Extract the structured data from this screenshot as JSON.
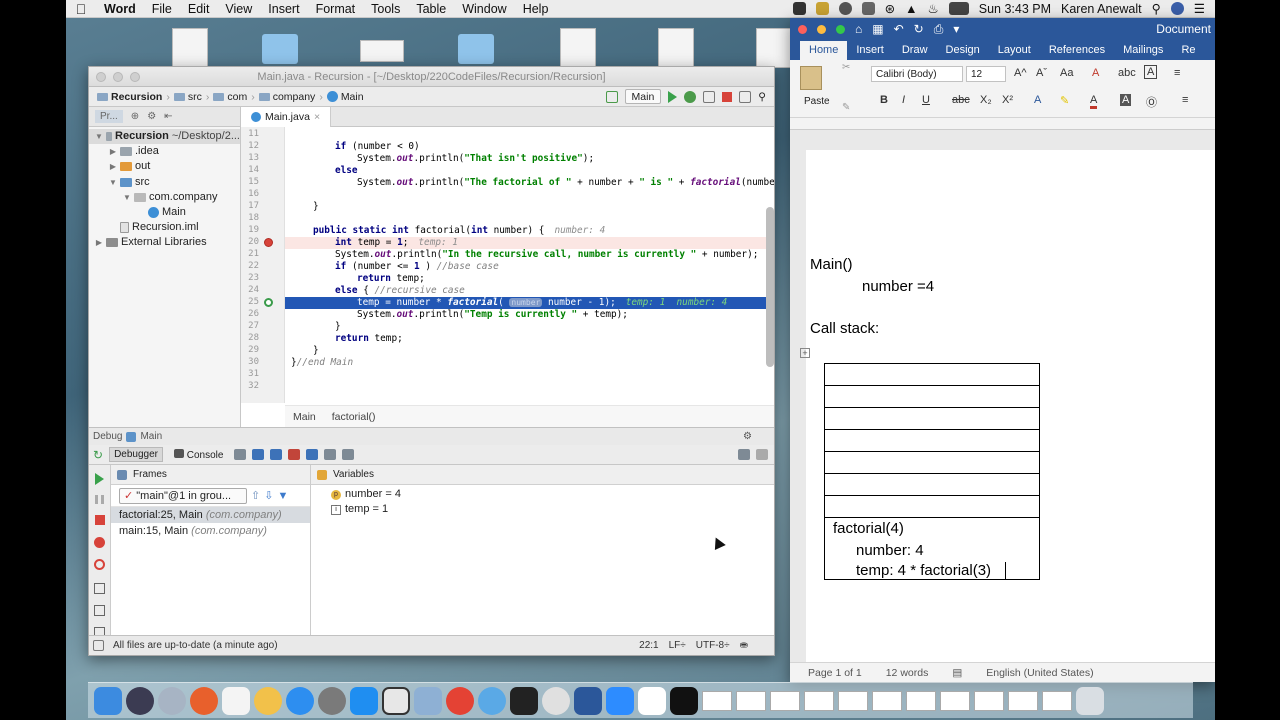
{
  "menubar": {
    "app": "Word",
    "items": [
      "File",
      "Edit",
      "View",
      "Insert",
      "Format",
      "Tools",
      "Table",
      "Window",
      "Help"
    ],
    "clock": "Sun 3:43 PM",
    "user": "Karen Anewalt"
  },
  "intellij": {
    "title": "Main.java - Recursion - [~/Desktop/220CodeFiles/Recursion/Recursion]",
    "nav": [
      "Recursion",
      "src",
      "com",
      "company",
      "Main"
    ],
    "run_config": "Main",
    "project_tab": "Pr...",
    "editor_tab": "Main.java",
    "tree": [
      {
        "label": "Recursion",
        "extra": "~/Desktop/2...",
        "icon": "gray",
        "indent": 0,
        "twisty": "▼",
        "bold": true
      },
      {
        "label": ".idea",
        "icon": "gray",
        "indent": 1,
        "twisty": "▶"
      },
      {
        "label": "out",
        "icon": "orange",
        "indent": 1,
        "twisty": "▶"
      },
      {
        "label": "src",
        "icon": "blue",
        "indent": 1,
        "twisty": "▼"
      },
      {
        "label": "com.company",
        "icon": "pkg",
        "indent": 2,
        "twisty": "▼"
      },
      {
        "label": "Main",
        "icon": "class",
        "indent": 3,
        "twisty": ""
      },
      {
        "label": "Recursion.iml",
        "icon": "file",
        "indent": 1,
        "twisty": ""
      },
      {
        "label": "External Libraries",
        "icon": "lib",
        "indent": 0,
        "twisty": "▶"
      }
    ],
    "line_numbers": [
      "11",
      "12",
      "13",
      "14",
      "15",
      "16",
      "17",
      "18",
      "19",
      "20",
      "21",
      "22",
      "23",
      "24",
      "25",
      "26",
      "27",
      "28",
      "29",
      "30",
      "31",
      "32"
    ],
    "code": {
      "l12_a": "if",
      "l12_b": " (number < 0)",
      "l13_a": "System.",
      "l13_b": "out",
      "l13_c": ".println(",
      "l13_d": "\"That isn't positive\"",
      "l13_e": ");",
      "l14": "else",
      "l15_a": "System.",
      "l15_b": "out",
      "l15_c": ".println(",
      "l15_d": "\"The factorial of \"",
      "l15_e": " + number + ",
      "l15_f": "\" is \"",
      "l15_g": " + ",
      "l15_h": "factorial",
      "l15_i": "(number",
      "l17": "}",
      "l19_a": "public static int",
      "l19_b": " factorial(",
      "l19_c": "int",
      "l19_d": " number) {",
      "l19_hint": "number: 4",
      "l20_a": "int",
      "l20_b": " temp = ",
      "l20_c": "1",
      "l20_d": ";",
      "l20_hint": "temp: 1",
      "l21_a": "System.",
      "l21_b": "out",
      "l21_c": ".println(",
      "l21_d": "\"In the recursive call, number is currently \"",
      "l21_e": " + number);",
      "l22_a": "if",
      "l22_b": " (number <= ",
      "l22_c": "1",
      "l22_d": " ) ",
      "l22_e": "//base case",
      "l23_a": "return",
      "l23_b": " temp;",
      "l24_a": "else",
      "l24_b": " { ",
      "l24_c": "//recursive case",
      "l25_a": "temp = number * ",
      "l25_b": "factorial",
      "l25_c": "( ",
      "l25_d": "number",
      "l25_e": " number - ",
      "l25_f": "1",
      "l25_g": ");",
      "l25_hint": "temp: 1  number: 4",
      "l26_a": "System.",
      "l26_b": "out",
      "l26_c": ".println(",
      "l26_d": "\"Temp is currently \"",
      "l26_e": " + temp);",
      "l27": "}",
      "l28_a": "return",
      "l28_b": " temp;",
      "l29": "}",
      "l30_a": "}",
      "l30_b": "//end Main"
    },
    "editor_breadcrumb": [
      "Main",
      "factorial()"
    ],
    "debug_label": "Debug",
    "debug_config": "Main",
    "debugger_tab": "Debugger",
    "console_tab": "Console",
    "frames_label": "Frames",
    "variables_label": "Variables",
    "thread": "\"main\"@1 in grou...",
    "frames": [
      {
        "method": "factorial:25, Main",
        "pkg": "(com.company)"
      },
      {
        "method": "main:15, Main",
        "pkg": "(com.company)"
      }
    ],
    "variables": [
      {
        "badge": "p",
        "text": "number = 4"
      },
      {
        "badge": "i",
        "text": "temp = 1"
      }
    ],
    "status": "All files are up-to-date (a minute ago)",
    "status_right": [
      "22:1",
      "LF÷",
      "UTF-8÷"
    ]
  },
  "word": {
    "title": "Document",
    "ribbon_tabs": [
      "Home",
      "Insert",
      "Draw",
      "Design",
      "Layout",
      "References",
      "Mailings",
      "Re"
    ],
    "font": "Calibri (Body)",
    "font_size": "12",
    "paste_label": "Paste",
    "doc": {
      "line1": "Main()",
      "line2": "number  =4",
      "line3": "Call stack:",
      "frame_title": "factorial(4)",
      "frame_number": "number: 4",
      "frame_temp": "temp: 4 * factorial(3)"
    },
    "status": {
      "pages": "Page 1 of 1",
      "words": "12 words",
      "language": "English (United States)"
    }
  },
  "colors": {
    "word_blue": "#2b579a",
    "exec_line": "#2257b5",
    "breakpoint": "#d7433a"
  }
}
